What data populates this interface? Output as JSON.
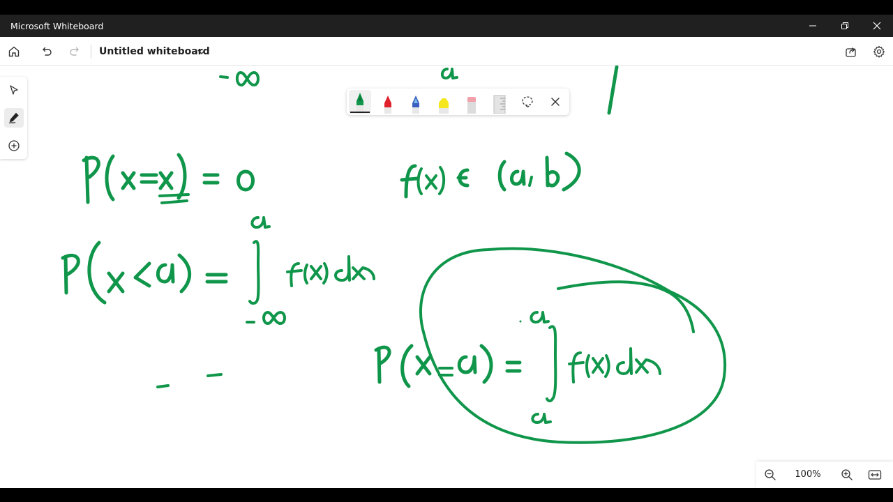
{
  "window": {
    "app_title": "Microsoft Whiteboard",
    "controls": [
      "minimize",
      "restore",
      "close"
    ]
  },
  "toolbar": {
    "board_title": "Untitled whiteboard",
    "icons": [
      "home-icon",
      "undo-icon",
      "redo-icon",
      "chevron-down-icon",
      "share-icon",
      "settings-gear-icon"
    ]
  },
  "left_rail": {
    "tools": [
      {
        "name": "select",
        "icon": "pointer-arrow-icon",
        "active": false
      },
      {
        "name": "ink",
        "icon": "pen-icon",
        "active": true
      },
      {
        "name": "add",
        "icon": "plus-circle-icon",
        "active": false
      }
    ]
  },
  "pen_tray": {
    "pens": [
      {
        "name": "green-pen",
        "color": "#10964a",
        "selected": true
      },
      {
        "name": "red-pen",
        "color": "#e0202a",
        "selected": false
      },
      {
        "name": "blue-pen",
        "color": "#3b5fc0",
        "selected": false
      },
      {
        "name": "yellow-highlighter",
        "color": "#f5e61e",
        "selected": false
      },
      {
        "name": "eraser",
        "color": "#f2a0aa",
        "selected": false
      },
      {
        "name": "ruler",
        "color": "#c8c8c8",
        "selected": false
      }
    ],
    "tools": [
      "lasso-select-icon",
      "close-icon"
    ]
  },
  "ink": {
    "color": "#10964a",
    "formulas": [
      "P(x=x) = 0",
      "P(x<a) = ∫ f(x)dx",
      "f(x) ∈ (a,b)",
      "P(x=a) = ∫ f(x)dx"
    ],
    "limits": {
      "top_upper": "a",
      "top_lower": "-∞",
      "mid_upper": "a",
      "mid_lower": "-∞",
      "circled_upper": "a",
      "circled_lower": "a"
    }
  },
  "zoom": {
    "level": "100%",
    "icons": [
      "zoom-out-icon",
      "zoom-in-icon",
      "fit-to-screen-icon"
    ]
  }
}
